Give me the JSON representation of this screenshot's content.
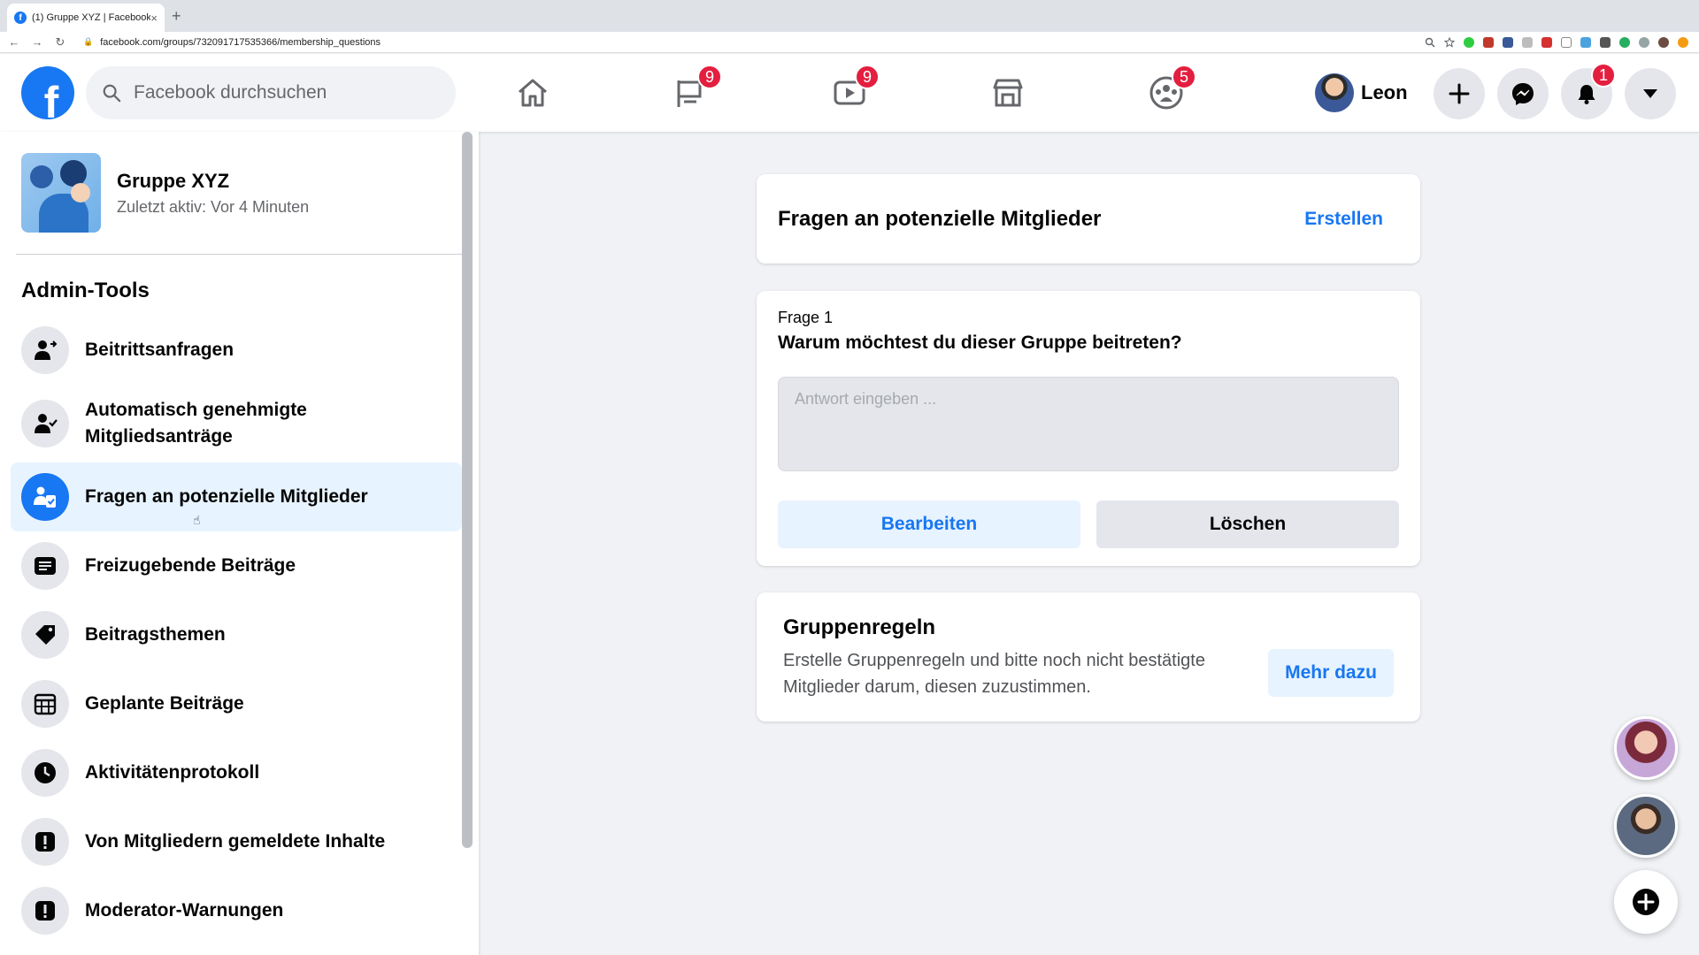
{
  "browser": {
    "tab_title": "(1) Gruppe XYZ | Facebook",
    "tab_close": "×",
    "new_tab": "+",
    "back": "←",
    "forward": "→",
    "reload": "↻",
    "url": "facebook.com/groups/732091717535366/membership_questions"
  },
  "header": {
    "logo": "f",
    "search_placeholder": "Facebook durchsuchen",
    "pages_badge": "9",
    "watch_badge": "9",
    "groups_badge": "5",
    "profile_name": "Leon",
    "notifications_badge": "1"
  },
  "sidebar": {
    "group_name": "Gruppe XYZ",
    "group_status": "Zuletzt aktiv: Vor 4 Minuten",
    "section_title": "Admin-Tools",
    "items": [
      {
        "label": "Beitrittsanfragen"
      },
      {
        "label": "Automatisch genehmigte Mitgliedsanträge"
      },
      {
        "label": "Fragen an potenzielle Mitglieder"
      },
      {
        "label": "Freizugebende Beiträge"
      },
      {
        "label": "Beitragsthemen"
      },
      {
        "label": "Geplante Beiträge"
      },
      {
        "label": "Aktivitätenprotokoll"
      },
      {
        "label": "Von Mitgliedern gemeldete Inhalte"
      },
      {
        "label": "Moderator-Warnungen"
      }
    ]
  },
  "main": {
    "questions_title": "Fragen an potenzielle Mitglieder",
    "create_label": "Erstellen",
    "question_number": "Frage 1",
    "question_text": "Warum möchtest du dieser Gruppe beitreten?",
    "answer_placeholder": "Antwort eingeben ...",
    "edit_label": "Bearbeiten",
    "delete_label": "Löschen",
    "rules_title": "Gruppenregeln",
    "rules_text": "Erstelle Gruppenregeln und bitte noch nicht bestätigte Mitglieder darum, diesen zuzustimmen.",
    "more_label": "Mehr dazu"
  },
  "colors": {
    "brand": "#1877f2",
    "badge": "#e41e3f",
    "active_bg": "#e7f3ff"
  }
}
